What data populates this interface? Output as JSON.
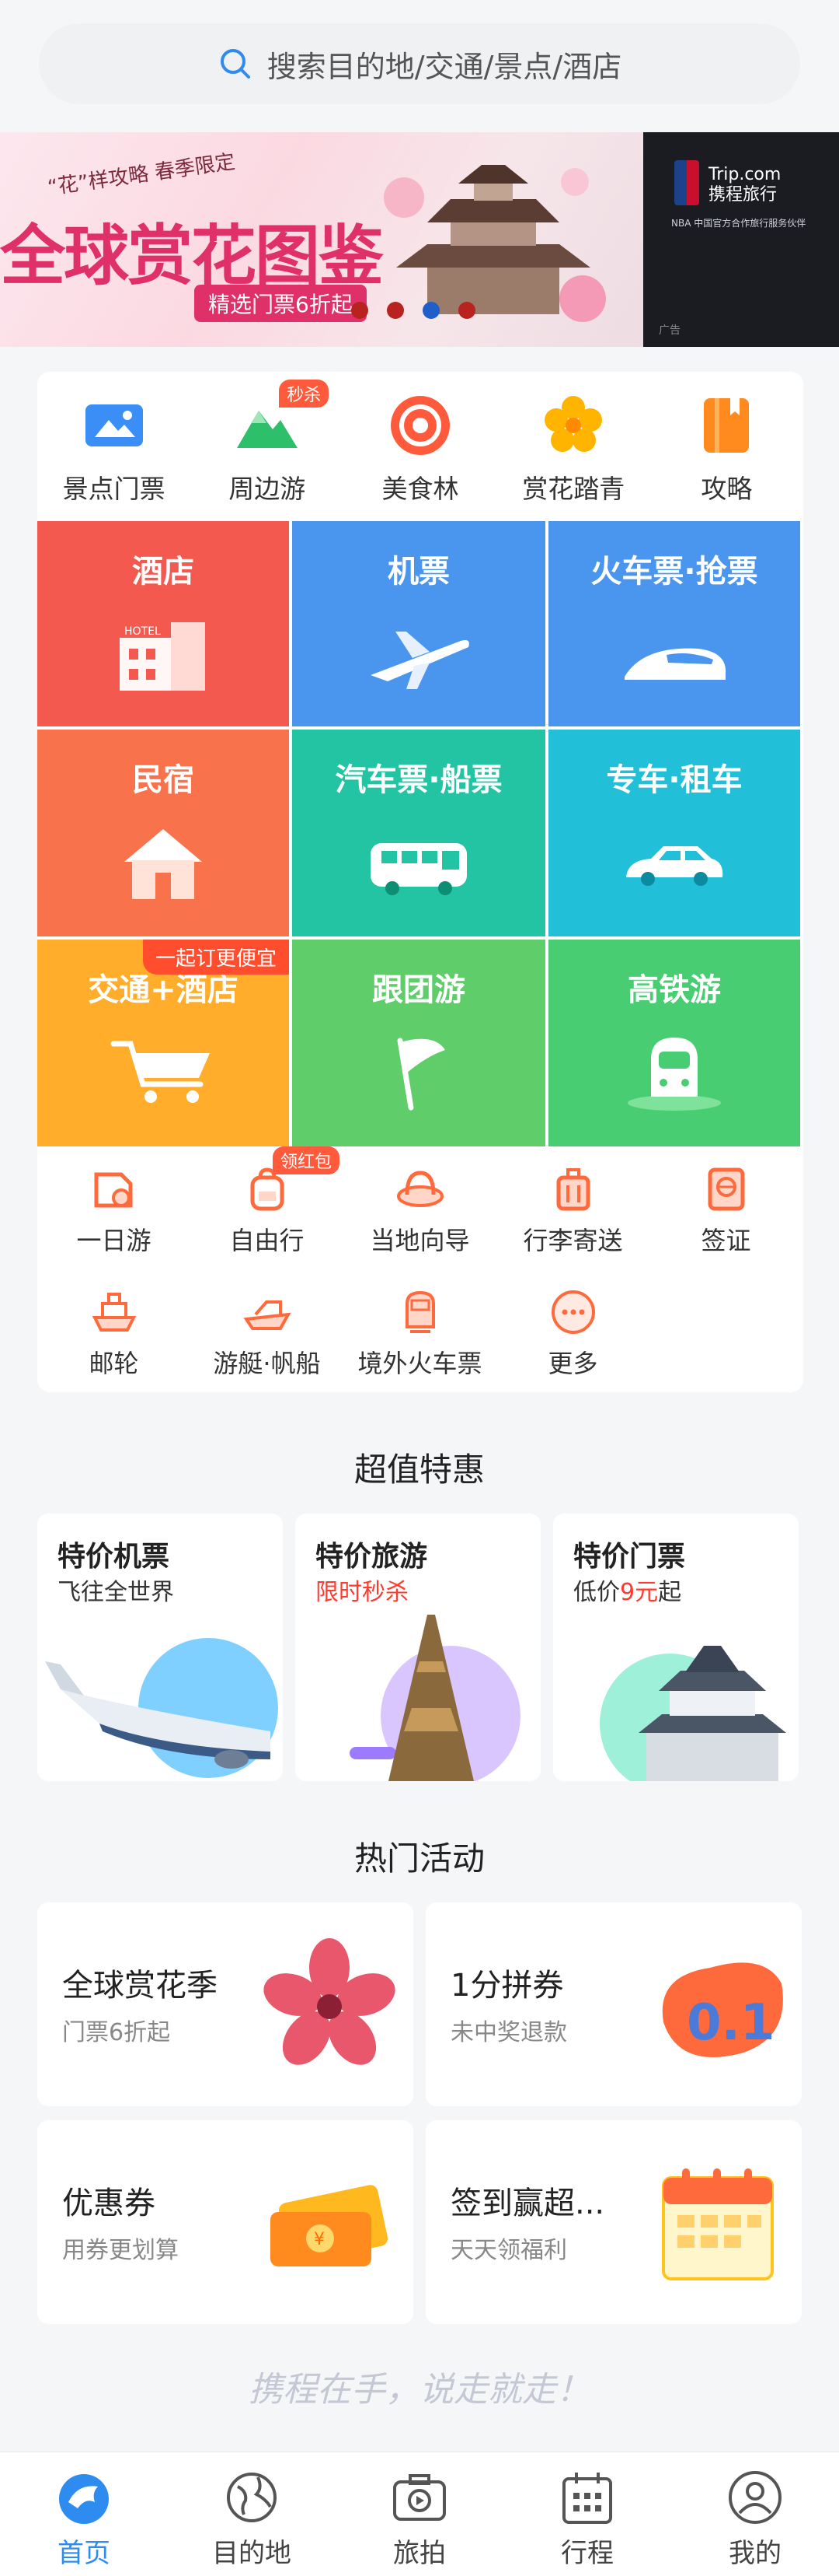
{
  "search": {
    "placeholder": "搜索目的地/交通/景点/酒店"
  },
  "banner": {
    "tag": "“花”样攻略 春季限定",
    "title": "全球赏花图鉴",
    "subtitle": "精选门票6折起",
    "side_brand_line1": "Trip.com",
    "side_brand_line2": "携程旅行",
    "side_caption": "NBA 中国官方合作旅行服务伙伴",
    "side_ad": "广告",
    "dots": 4,
    "active_dot": 3
  },
  "top_icons": [
    {
      "label": "景点门票",
      "icon": "ticket-icon",
      "color": "#3a8ef5"
    },
    {
      "label": "周边游",
      "icon": "mountain-icon",
      "color": "#2dbf6a",
      "badge": "秒杀"
    },
    {
      "label": "美食林",
      "icon": "food-icon",
      "color": "#ff5a3c"
    },
    {
      "label": "赏花踏青",
      "icon": "flower-icon",
      "color": "#ffb400"
    },
    {
      "label": "攻略",
      "icon": "guide-book-icon",
      "color": "#ff8a1e"
    }
  ],
  "tiles": [
    {
      "label": "酒店",
      "color": "#f4594f"
    },
    {
      "label": "机票",
      "color": "#4a95ee"
    },
    {
      "label": "火车票·抢票",
      "color": "#4a95ee"
    },
    {
      "label": "民宿",
      "color": "#f8724b"
    },
    {
      "label": "汽车票·船票",
      "color": "#22c4a3"
    },
    {
      "label": "专车·租车",
      "color": "#22bfd8"
    },
    {
      "label": "交通+酒店",
      "color": "#ffad2a",
      "ribbon": "一起订更便宜"
    },
    {
      "label": "跟团游",
      "color": "#5fcd69"
    },
    {
      "label": "高铁游",
      "color": "#49cd72"
    }
  ],
  "small_icons_row1": [
    {
      "label": "一日游",
      "icon": "one-day-tour-icon"
    },
    {
      "label": "自由行",
      "icon": "backpack-icon",
      "badge": "领红包"
    },
    {
      "label": "当地向导",
      "icon": "guide-hat-icon"
    },
    {
      "label": "行李寄送",
      "icon": "luggage-icon"
    },
    {
      "label": "签证",
      "icon": "passport-icon"
    }
  ],
  "small_icons_row2": [
    {
      "label": "邮轮",
      "icon": "cruise-icon"
    },
    {
      "label": "游艇·帆船",
      "icon": "yacht-icon"
    },
    {
      "label": "境外火车票",
      "icon": "train-icon"
    },
    {
      "label": "更多",
      "icon": "more-icon"
    }
  ],
  "deals_title": "超值特惠",
  "deals": [
    {
      "title": "特价机票",
      "sub": "飞往全世界"
    },
    {
      "title": "特价旅游",
      "sub_red": "限时秒杀"
    },
    {
      "title": "特价门票",
      "sub_pre": "低价",
      "sub_red": "9元",
      "sub_post": "起"
    }
  ],
  "activities_title": "热门活动",
  "activities": [
    {
      "title": "全球赏花季",
      "sub": "门票6折起"
    },
    {
      "title": "1分拼券",
      "sub": "未中奖退款"
    },
    {
      "title": "优惠券",
      "sub": "用券更划算"
    },
    {
      "title": "签到赢超...",
      "sub": "天天领福利"
    }
  ],
  "slogan": "携程在手，说走就走！",
  "tabs": [
    {
      "label": "首页",
      "active": true
    },
    {
      "label": "目的地"
    },
    {
      "label": "旅拍"
    },
    {
      "label": "行程"
    },
    {
      "label": "我的"
    }
  ],
  "colors": {
    "accent": "#2e8cf0",
    "red": "#ff3b30"
  }
}
